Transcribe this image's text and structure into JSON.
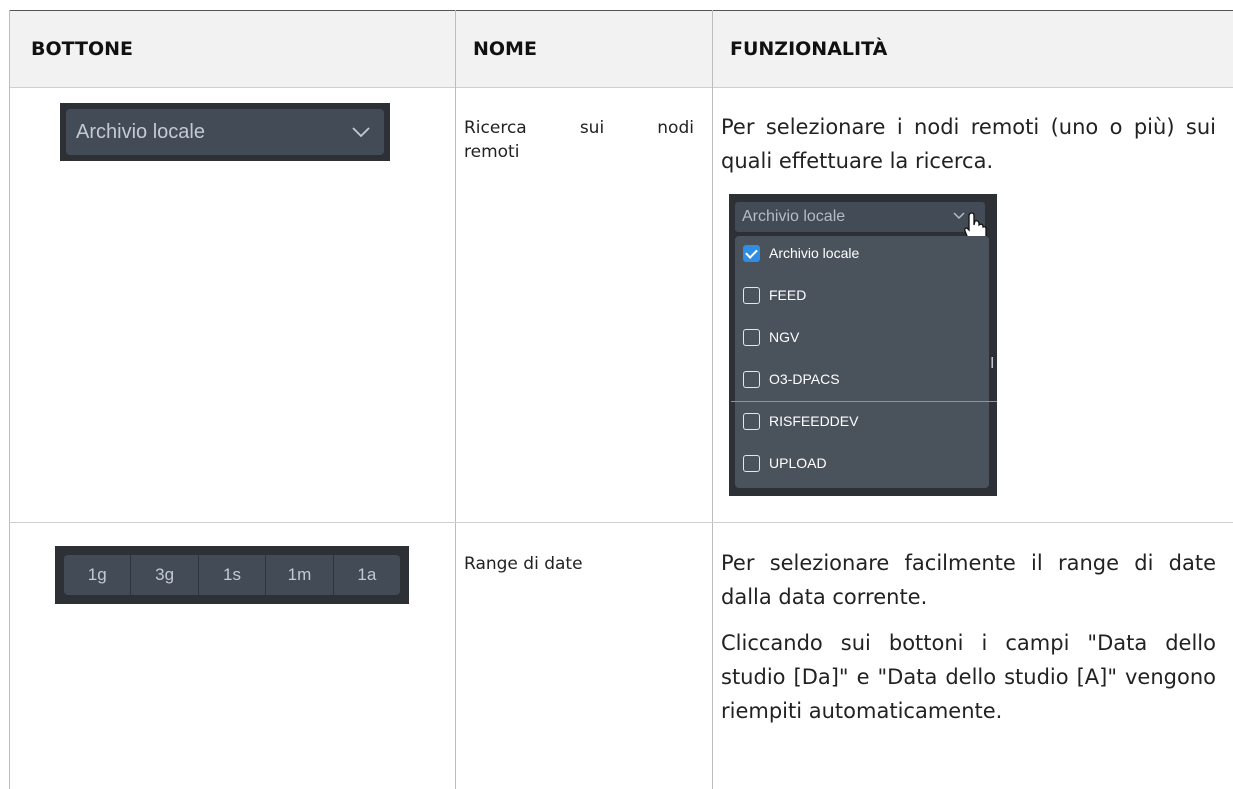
{
  "table": {
    "headers": [
      "BOTTONE",
      "NOME",
      "FUNZIONALITÀ"
    ],
    "rows": [
      {
        "widget": {
          "dropdown_value": "Archivio locale"
        },
        "name_line1": [
          "Ricerca",
          "sui",
          "nodi"
        ],
        "name_line2": "remoti",
        "func_text": "Per selezionare i nodi remoti (uno o più) sui quali effettuare la ricerca.",
        "dropdown_open": {
          "value": "Archivio locale",
          "options": [
            {
              "label": "Archivio locale",
              "checked": true
            },
            {
              "label": "FEED",
              "checked": false
            },
            {
              "label": "NGV",
              "checked": false
            },
            {
              "label": "O3-DPACS",
              "checked": false
            },
            {
              "label": "RISFEEDDEV",
              "checked": false
            },
            {
              "label": "UPLOAD",
              "checked": false
            }
          ],
          "stray_letter": "I"
        }
      },
      {
        "widget": {
          "range_buttons": [
            "1g",
            "3g",
            "1s",
            "1m",
            "1a"
          ]
        },
        "name": "Range di date",
        "func_p1": "Per selezionare facilmente il range di date dalla data corrente.",
        "func_p2": "Cliccando sui bottoni i campi \"Data dello studio [Da]\" e \"Data dello studio [A]\" vengono riempiti automaticamente."
      }
    ]
  },
  "colors": {
    "header_bg": "#f2f2f2",
    "widget_bg": "#2d3135",
    "control_bg": "#424b56",
    "checkbox_checked": "#2f8de4"
  }
}
